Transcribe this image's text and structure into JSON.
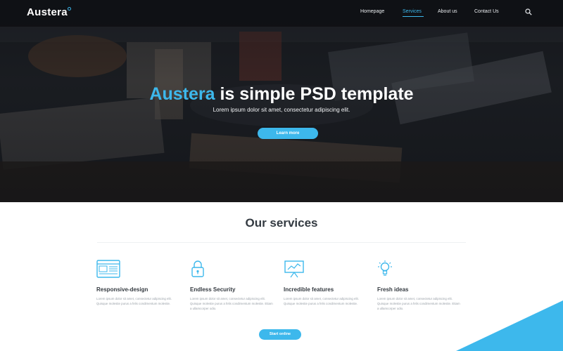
{
  "brand": {
    "logo": "Austera",
    "accent_color": "#3db8ec"
  },
  "nav": {
    "items": [
      {
        "label": "Homepage",
        "active": false
      },
      {
        "label": "Services",
        "active": true
      },
      {
        "label": "About us",
        "active": false
      },
      {
        "label": "Contact Us",
        "active": false
      }
    ],
    "search_icon": "search-icon"
  },
  "hero": {
    "title_accent": "Austera",
    "title_rest": " is simple PSD template",
    "subtitle": "Lorem ipsum dolor sit amet, consectetur adipiscing elit.",
    "button_label": "Learn more"
  },
  "services": {
    "title": "Our services",
    "items": [
      {
        "icon": "browser-window-icon",
        "title": "Responsive-design",
        "text": "Lorem ipsum dolor sit amet, consectetur adipiscing elit. Quisque molestie purus a felis condimentum molestie."
      },
      {
        "icon": "padlock-icon",
        "title": "Endless Security",
        "text": "Lorem ipsum dolor sit amet, consectetur adipiscing elit. Quisque molestie purus a felis condimentum molestie. Etiam a ullamcorper odio."
      },
      {
        "icon": "presentation-board-icon",
        "title": "Incredible features",
        "text": "Lorem ipsum dolor sit amet, consectetur adipiscing elit. Quisque molestie purus a felis condimentum molestie."
      },
      {
        "icon": "lightbulb-icon",
        "title": "Fresh ideas",
        "text": "Lorem ipsum dolor sit amet, consectetur adipiscing elit. Quisque molestie purus a felis condimentum molestie. Etiam a ullamcorper odio."
      }
    ],
    "button_label": "Start online"
  }
}
